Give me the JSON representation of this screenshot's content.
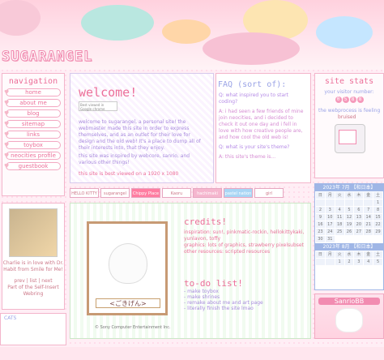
{
  "header": {
    "logo": "SUGARANGEL"
  },
  "nav": {
    "title": "navigation",
    "items": [
      "home",
      "about me",
      "blog",
      "sitemap",
      "links",
      "toybox",
      "neocities profile",
      "guestbook"
    ]
  },
  "welcome": {
    "title": "welcome!",
    "badge": "Best viewed in Google chrome",
    "body_1": "welcome to sugarangel, a personal site! the webmaster made this site in order to express themselves, and as an outlet for their love for design and the old web! It's a place to dump all of their interests into, that they enjoy.",
    "body_2": "this site was inspired by webcore, sanrio, and various other things!",
    "footnote": "this site is best viewed on a 1920 x 1080"
  },
  "faq": {
    "title": "FAQ (sort of):",
    "q1": "Q: what inspired you to start coding?",
    "a1": "A: i had seen a few friends of mine join neocities, and i decided to check it out one day and i fell in love with how creative people are, and how cool the old web is!",
    "q2": "Q: what is your site's theme?",
    "a2": "A: this site's theme is..."
  },
  "stats": {
    "title": "site stats",
    "visitor_label": "your visitor number:",
    "counter": [
      "0",
      "5",
      "8",
      "8"
    ],
    "webprocess": "the webprocess is feeling",
    "status": "bruised"
  },
  "buttons": [
    "HELLO KITTY",
    "sugarangel",
    "Chippy Place",
    "Kaoru",
    "hachimaki",
    "pastel nation",
    "girl"
  ],
  "credits": {
    "title": "credits!",
    "inspiration_k": "inspiration:",
    "inspiration_v": "sun!, pinkmatic-rockin, hellokittykaki, yunlavon, toffy",
    "graphics_k": "graphics:",
    "graphics_v": "lots of graphics, strawberry pixelsubset",
    "other_k": "other resources:",
    "other_v": "scripted resources"
  },
  "todo": {
    "title": "to-do list!",
    "items": [
      "- make toybox",
      "- make shrines",
      "- remake about me and art page",
      "- literally finish the site lmao"
    ]
  },
  "character": {
    "tag": "<ごきげん>",
    "copyright": "© Sony Computer Entertainment Inc."
  },
  "webring": {
    "line": "Charlie is in love with Dr. Habit from Smile for Me!",
    "nav": "prev | list | next",
    "part": "Part of the Self-Insert Webring"
  },
  "calendar": {
    "month1": "2023年 7月 【和日本】",
    "month2": "2023年 8月 【和日本】",
    "weekdays": [
      "日",
      "月",
      "火",
      "水",
      "木",
      "金",
      "土"
    ],
    "days1": [
      "",
      "",
      "",
      "",
      "",
      "",
      "1",
      "2",
      "3",
      "4",
      "5",
      "6",
      "7",
      "8",
      "9",
      "10",
      "11",
      "12",
      "13",
      "14",
      "15",
      "16",
      "17",
      "18",
      "19",
      "20",
      "21",
      "22",
      "23",
      "24",
      "25",
      "26",
      "27",
      "28",
      "29",
      "30",
      "31"
    ],
    "days2": [
      "",
      "",
      "1",
      "2",
      "3",
      "4",
      "5"
    ]
  },
  "sanrio": {
    "label": "SanrioBB"
  },
  "footer": {
    "text": "CATS"
  }
}
